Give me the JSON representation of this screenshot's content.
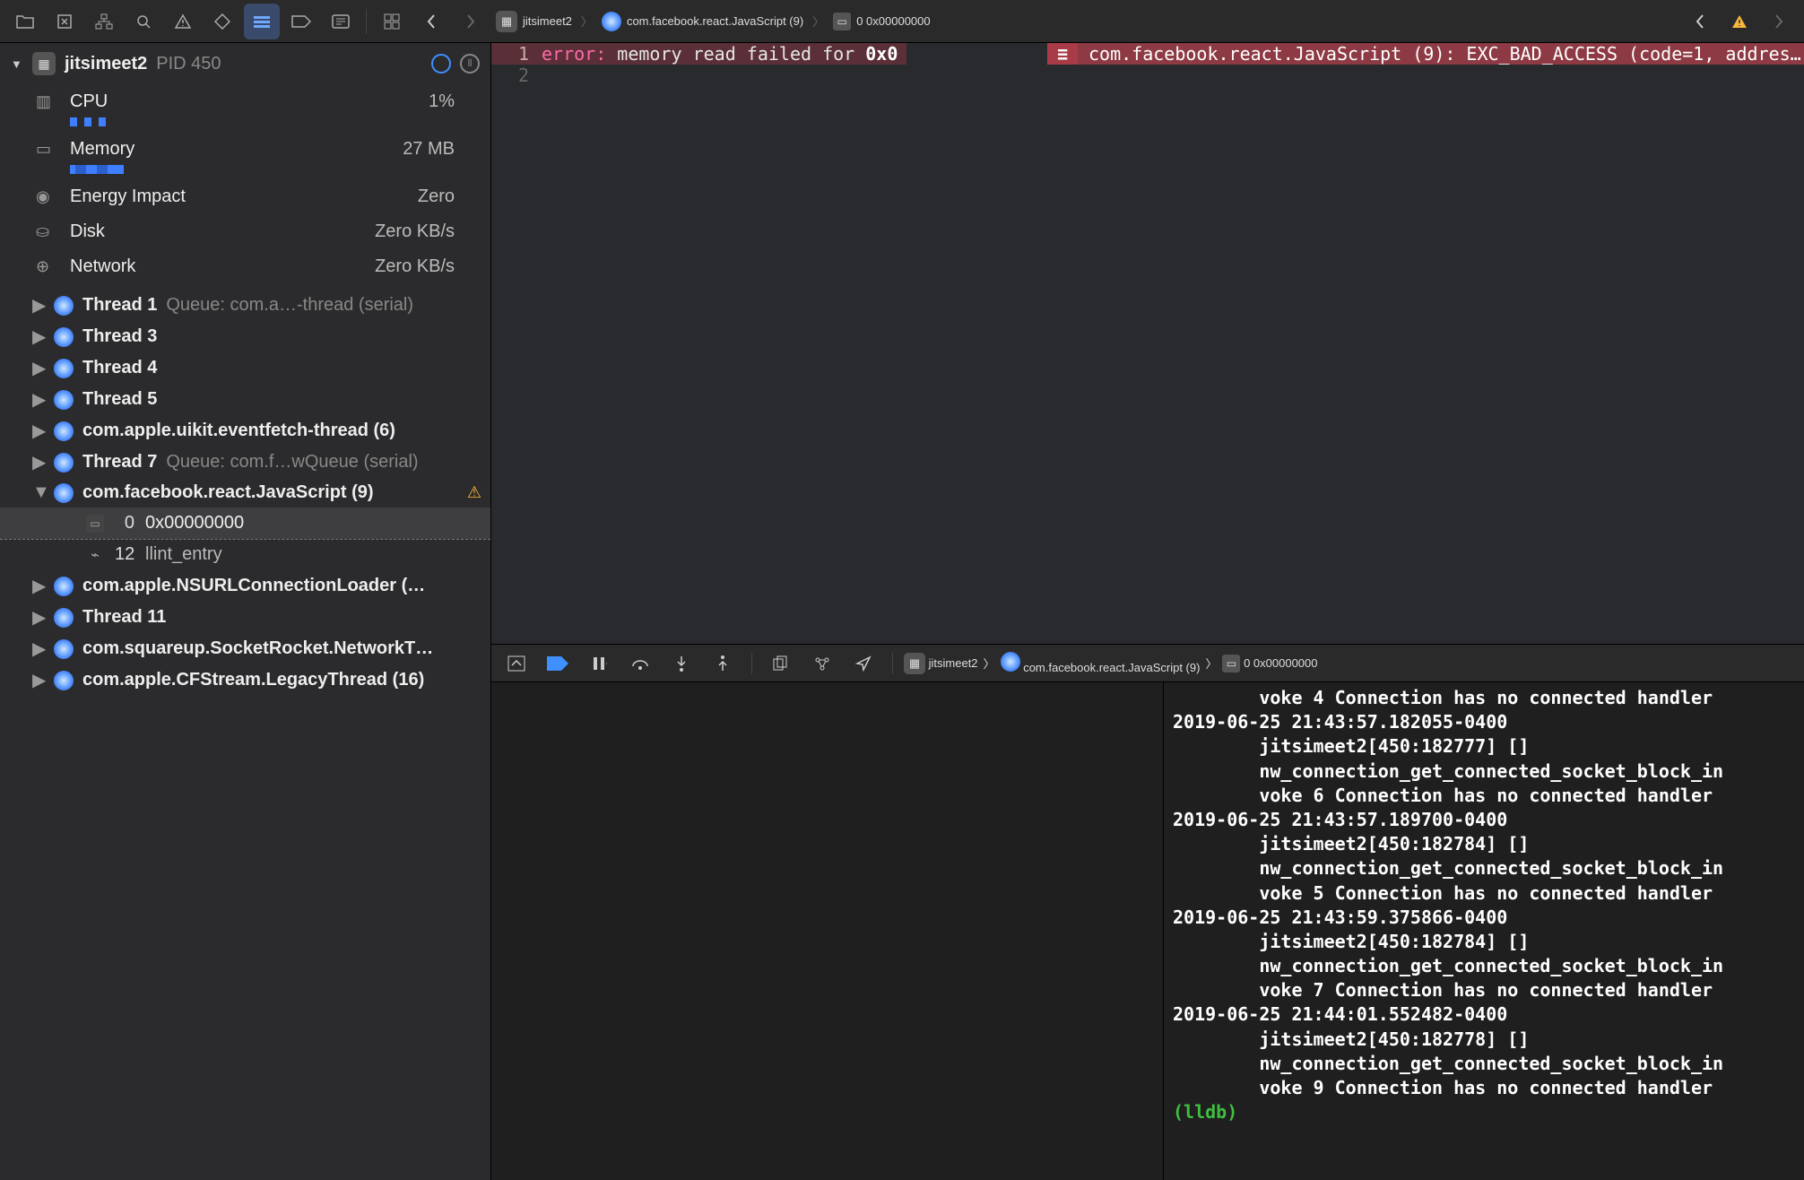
{
  "toolbar_left": [
    "folder",
    "box",
    "hierarchy",
    "search",
    "warning",
    "swap",
    "list",
    "tag",
    "comments"
  ],
  "breadcrumb_top": {
    "app": "jitsimeet2",
    "thread": "com.facebook.react.JavaScript (9)",
    "frame": "0 0x00000000"
  },
  "breadcrumb_bottom": {
    "app": "jitsimeet2",
    "thread": "com.facebook.react.JavaScript (9)",
    "frame": "0 0x00000000"
  },
  "process": {
    "name": "jitsimeet2",
    "pid_label": "PID 450"
  },
  "metrics": {
    "cpu": {
      "label": "CPU",
      "value": "1%"
    },
    "memory": {
      "label": "Memory",
      "value": "27 MB"
    },
    "energy": {
      "label": "Energy Impact",
      "value": "Zero"
    },
    "disk": {
      "label": "Disk",
      "value": "Zero KB/s"
    },
    "network": {
      "label": "Network",
      "value": "Zero KB/s"
    }
  },
  "threads": [
    {
      "name": "Thread 1",
      "queue": "Queue: com.a…-thread (serial)",
      "expanded": false
    },
    {
      "name": "Thread 3",
      "queue": "",
      "expanded": false
    },
    {
      "name": "Thread 4",
      "queue": "",
      "expanded": false
    },
    {
      "name": "Thread 5",
      "queue": "",
      "expanded": false
    },
    {
      "name": "com.apple.uikit.eventfetch-thread (6)",
      "queue": "",
      "expanded": false
    },
    {
      "name": "Thread 7",
      "queue": "Queue: com.f…wQueue (serial)",
      "expanded": false
    },
    {
      "name": "com.facebook.react.JavaScript (9)",
      "queue": "",
      "expanded": true,
      "warn": true,
      "frames": [
        {
          "idx": "0",
          "label": "0x00000000",
          "selected": true,
          "icon": "asm"
        },
        {
          "idx": "12",
          "label": "llint_entry",
          "selected": false,
          "icon": "js"
        }
      ]
    },
    {
      "name": "com.apple.NSURLConnectionLoader (…",
      "queue": "",
      "expanded": false
    },
    {
      "name": "Thread 11",
      "queue": "",
      "expanded": false
    },
    {
      "name": "com.squareup.SocketRocket.NetworkT…",
      "queue": "",
      "expanded": false
    },
    {
      "name": "com.apple.CFStream.LegacyThread (16)",
      "queue": "",
      "expanded": false
    }
  ],
  "editor": {
    "line1_gutter": "1",
    "line2_gutter": "2",
    "err_prefix": "error: ",
    "err_body": "memory read failed for ",
    "err_addr": "0x0",
    "err_mid": "≡",
    "err_right": "com.facebook.react.JavaScript (9): EXC_BAD_ACCESS (code=1, addres…"
  },
  "console_log": [
    "        voke 4 Connection has no connected handler",
    "2019-06-25 21:43:57.182055-0400",
    "        jitsimeet2[450:182777] []",
    "        nw_connection_get_connected_socket_block_in",
    "        voke 6 Connection has no connected handler",
    "2019-06-25 21:43:57.189700-0400",
    "        jitsimeet2[450:182784] []",
    "        nw_connection_get_connected_socket_block_in",
    "        voke 5 Connection has no connected handler",
    "2019-06-25 21:43:59.375866-0400",
    "        jitsimeet2[450:182784] []",
    "        nw_connection_get_connected_socket_block_in",
    "        voke 7 Connection has no connected handler",
    "2019-06-25 21:44:01.552482-0400",
    "        jitsimeet2[450:182778] []",
    "        nw_connection_get_connected_socket_block_in",
    "        voke 9 Connection has no connected handler"
  ],
  "lldb_prompt": "(lldb) "
}
